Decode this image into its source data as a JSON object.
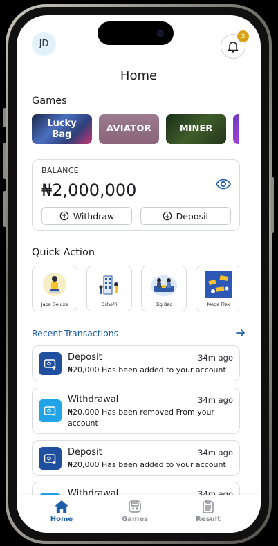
{
  "header": {
    "avatar_initials": "JD",
    "notification_count": "3",
    "title": "Home"
  },
  "games": {
    "section_title": "Games",
    "items": [
      {
        "label": "Lucky\nBag"
      },
      {
        "label": "AVIATOR"
      },
      {
        "label": "MINER"
      },
      {
        "label": ""
      }
    ]
  },
  "balance": {
    "label": "BALANCE",
    "amount": "₦2,000,000",
    "withdraw_label": "Withdraw",
    "deposit_label": "Deposit"
  },
  "quick_action": {
    "section_title": "Quick Action",
    "items": [
      {
        "label": "Japa Deluxe"
      },
      {
        "label": "Oshofri"
      },
      {
        "label": "Big Bag"
      },
      {
        "label": "Mega Flex"
      }
    ]
  },
  "recent_transactions": {
    "title": "Recent Transactions",
    "items": [
      {
        "type": "Deposit",
        "time": "34m ago",
        "description": "₦20,000 Has been added to your account"
      },
      {
        "type": "Withdrawal",
        "time": "34m ago",
        "description": "₦20,000 Has been removed From your account"
      },
      {
        "type": "Deposit",
        "time": "34m ago",
        "description": "₦20,000 Has been added to your account"
      },
      {
        "type": "Withdrawal",
        "time": "34m ago",
        "description": ""
      }
    ]
  },
  "tabbar": {
    "tabs": [
      {
        "label": "Home",
        "active": true
      },
      {
        "label": "Games",
        "active": false
      },
      {
        "label": "Result",
        "active": false
      }
    ]
  },
  "colors": {
    "accent": "#1f5fa8",
    "badge": "#d7a316",
    "deposit_icon_bg": "#1f4f9e",
    "withdrawal_icon_bg": "#21a3e8"
  }
}
